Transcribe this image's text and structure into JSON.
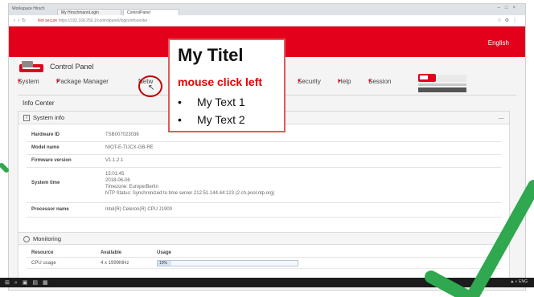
{
  "browser": {
    "window_label": "Workspace Hirsch",
    "tabs": [
      {
        "label": "My HirschmannLogin",
        "active": false
      },
      {
        "label": "ControlPanel",
        "active": true
      }
    ],
    "url_secure": "Not secure",
    "url_text": "https://192.168.250.1/controlpanel/login/infocenter"
  },
  "header": {
    "language": "English",
    "app_title": "Control Panel",
    "menu": [
      {
        "label": "System"
      },
      {
        "label": "Package Manager"
      },
      {
        "label": "Netw"
      },
      {
        "label": "Security"
      },
      {
        "label": "Help"
      },
      {
        "label": "Session"
      }
    ],
    "brand": "hirschmann"
  },
  "page": {
    "title": "Info Center"
  },
  "system_info": {
    "heading": "System info",
    "rows": [
      {
        "label": "Hardware ID",
        "value": [
          "TSB007023036"
        ]
      },
      {
        "label": "Model name",
        "value": [
          "NIOT-E-TIJCX-GB-RE"
        ]
      },
      {
        "label": "Firmware version",
        "value": [
          "V1.1.2.1"
        ]
      },
      {
        "label": "System time",
        "value": [
          "15:01:45",
          "2018-06-06",
          "Timezone: Europe/Berlin",
          "NTP Status: Synchronized to time server 212.51.144.44:123 (2.ch.pool.ntp.org)"
        ]
      },
      {
        "label": "Processor name",
        "value": [
          "Intel(R) Celeron(R) CPU J1900"
        ]
      }
    ]
  },
  "monitoring": {
    "heading": "Monitoring",
    "columns": [
      "Resource",
      "Available",
      "Usage"
    ],
    "rows": [
      {
        "resource": "CPU usage",
        "available": "4 x 1999MHz",
        "usage_label": "10%",
        "usage_fraction": 0.1
      }
    ]
  },
  "callout": {
    "title": "My Titel",
    "subtitle": "mouse click left",
    "bullets": [
      "My Text 1",
      "My Text 2"
    ]
  },
  "colors": {
    "brand_red": "#e3001b",
    "callout_border": "#e05a5a",
    "callout_subtitle": "#e60000",
    "check_green": "#2fa84f",
    "click_ring": "#c00000"
  }
}
